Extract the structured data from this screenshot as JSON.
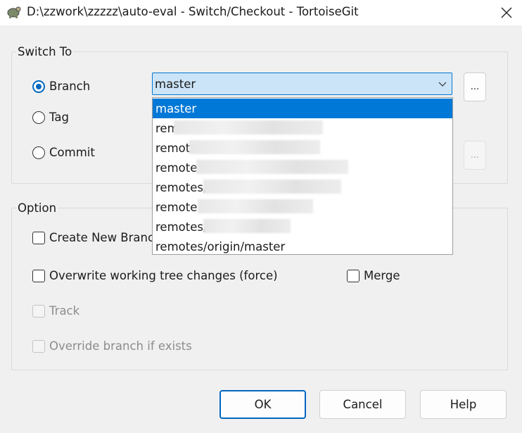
{
  "window": {
    "title": "D:\\zzwork\\zzzzz\\auto-eval - Switch/Checkout - TortoiseGit"
  },
  "switch_to": {
    "legend": "Switch To",
    "branch_label": "Branch",
    "tag_label": "Tag",
    "commit_label": "Commit",
    "selected_branch": "master",
    "browse_label": "...",
    "commit_browse_label": "...",
    "dropdown_items": [
      "master",
      "rem",
      "remot",
      "remote",
      "remotes/",
      "remote",
      "remotes/",
      "remotes/origin/master"
    ]
  },
  "option": {
    "legend": "Option",
    "create_new_branch_label": "Create New Branch",
    "overwrite_label": "Overwrite working tree changes (force)",
    "merge_label": "Merge",
    "track_label": "Track",
    "override_label": "Override branch if exists"
  },
  "buttons": {
    "ok": "OK",
    "cancel": "Cancel",
    "help": "Help"
  },
  "colors": {
    "accent": "#0067c0",
    "selection": "#0078d7",
    "combo_bg": "#cce4f7"
  },
  "icons": {
    "app": "tortoise-icon",
    "close": "close-icon",
    "dropdown": "chevron-down-icon"
  }
}
